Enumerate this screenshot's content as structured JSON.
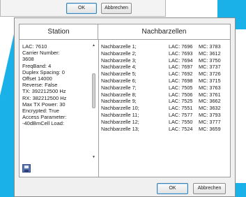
{
  "top_dialog": {
    "ok_label": "OK",
    "cancel_label": "Abbrechen"
  },
  "dialog": {
    "station_header": "Station",
    "neighbors_header": "Nachbarzellen",
    "station_lines": [
      "LAC: 7610",
      "Carrier Number:",
      "3608",
      "FreqBand: 4",
      "Duplex Spacing: 0",
      "Offset 14000",
      "Reverse: False",
      "TX: 392212500 Hz",
      "RX: 382212500 Hz",
      "Max TX Power: 30",
      "Encrypted: True",
      "Access Parameter:",
      "-40dBmCell Load:"
    ],
    "neighbors": [
      {
        "name": "Nachbarzelle 1;",
        "lac": "LAC: 7696",
        "mc": "MC: 3783"
      },
      {
        "name": "Nachbarzelle 2;",
        "lac": "LAC: 7693",
        "mc": "MC: 3612"
      },
      {
        "name": "Nachbarzelle 3;",
        "lac": "LAC: 7694",
        "mc": "MC: 3750"
      },
      {
        "name": "Nachbarzelle 4;",
        "lac": "LAC: 7697",
        "mc": "MC: 3737"
      },
      {
        "name": "Nachbarzelle 5;",
        "lac": "LAC: 7692",
        "mc": "MC: 3726"
      },
      {
        "name": "Nachbarzelle 6;",
        "lac": "LAC: 7698",
        "mc": "MC: 3715"
      },
      {
        "name": "Nachbarzelle 7;",
        "lac": "LAC: 7505",
        "mc": "MC: 3763"
      },
      {
        "name": "Nachbarzelle 8;",
        "lac": "LAC: 7506",
        "mc": "MC: 3761"
      },
      {
        "name": "Nachbarzelle 9;",
        "lac": "LAC: 7525",
        "mc": "MC: 3662"
      },
      {
        "name": "Nachbarzelle 10;",
        "lac": "LAC: 7551",
        "mc": "MC: 3632"
      },
      {
        "name": "Nachbarzelle 11;",
        "lac": "LAC: 7577",
        "mc": "MC: 3793"
      },
      {
        "name": "Nachbarzelle 12;",
        "lac": "LAC: 7550",
        "mc": "MC: 3777"
      },
      {
        "name": "Nachbarzelle 13;",
        "lac": "LAC: 7524",
        "mc": "MC: 3659"
      }
    ],
    "ok_label": "OK",
    "cancel_label": "Abbrechen"
  },
  "icons": {
    "save": "save-icon"
  },
  "colors": {
    "accent": "#1ab1e8"
  }
}
